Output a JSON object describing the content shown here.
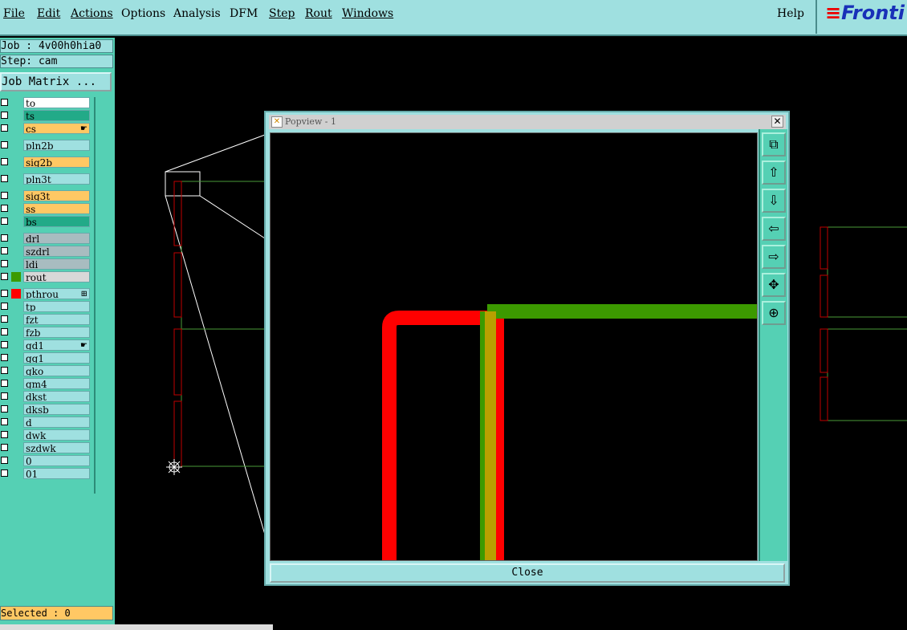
{
  "menu": {
    "file": "File",
    "edit": "Edit",
    "actions": "Actions",
    "options": "Options",
    "analysis": "Analysis",
    "dfm": "DFM",
    "step": "Step",
    "rout": "Rout",
    "windows": "Windows",
    "help": "Help"
  },
  "brand": {
    "logo": "Fronti",
    "color": "#1830b8"
  },
  "panel": {
    "job": "Job : 4v00h0hia0",
    "step": "Step: cam",
    "job_matrix": "Job Matrix ...",
    "selected": "Selected : 0"
  },
  "layers": [
    {
      "name": "to",
      "bg": "#ffffff",
      "swatch": "",
      "mark": ""
    },
    {
      "name": "ts",
      "bg": "#22aa88",
      "swatch": "",
      "mark": ""
    },
    {
      "name": "cs",
      "bg": "#ffc864",
      "swatch": "",
      "mark": "hand-icon"
    },
    {
      "name": "pln2b",
      "bg": "#9fe0e0",
      "swatch": "",
      "mark": ""
    },
    {
      "name": "sig2b",
      "bg": "#ffc864",
      "swatch": "",
      "mark": ""
    },
    {
      "name": "pln3t",
      "bg": "#9fe0e0",
      "swatch": "",
      "mark": ""
    },
    {
      "name": "sig3t",
      "bg": "#ffc864",
      "swatch": "",
      "mark": ""
    },
    {
      "name": "ss",
      "bg": "#ffc864",
      "swatch": "",
      "mark": ""
    },
    {
      "name": "bs",
      "bg": "#22aa88",
      "swatch": "",
      "mark": ""
    },
    {
      "name": "drl",
      "bg": "#a8bcc0",
      "swatch": "",
      "mark": ""
    },
    {
      "name": "szdrl",
      "bg": "#a8bcc0",
      "swatch": "",
      "mark": ""
    },
    {
      "name": "ldi",
      "bg": "#a8bcc0",
      "swatch": "",
      "mark": ""
    },
    {
      "name": "rout",
      "bg": "#d8d8d8",
      "swatch": "#3c9a00",
      "mark": ""
    },
    {
      "name": "pthrou",
      "bg": "#9fe0e0",
      "swatch": "#ff0000",
      "mark": "grid-icon"
    },
    {
      "name": "tp",
      "bg": "#9fe0e0",
      "swatch": "",
      "mark": ""
    },
    {
      "name": "fzt",
      "bg": "#9fe0e0",
      "swatch": "",
      "mark": ""
    },
    {
      "name": "fzb",
      "bg": "#9fe0e0",
      "swatch": "",
      "mark": ""
    },
    {
      "name": "gd1",
      "bg": "#9fe0e0",
      "swatch": "",
      "mark": "hand-icon"
    },
    {
      "name": "gg1",
      "bg": "#9fe0e0",
      "swatch": "",
      "mark": ""
    },
    {
      "name": "gko",
      "bg": "#9fe0e0",
      "swatch": "",
      "mark": ""
    },
    {
      "name": "gm4",
      "bg": "#9fe0e0",
      "swatch": "",
      "mark": ""
    },
    {
      "name": "dkst",
      "bg": "#9fe0e0",
      "swatch": "",
      "mark": ""
    },
    {
      "name": "dksb",
      "bg": "#9fe0e0",
      "swatch": "",
      "mark": ""
    },
    {
      "name": "d",
      "bg": "#9fe0e0",
      "swatch": "",
      "mark": ""
    },
    {
      "name": "dwk",
      "bg": "#9fe0e0",
      "swatch": "",
      "mark": ""
    },
    {
      "name": "szdwk",
      "bg": "#9fe0e0",
      "swatch": "",
      "mark": ""
    },
    {
      "name": "0",
      "bg": "#9fe0e0",
      "swatch": "",
      "mark": ""
    },
    {
      "name": "01",
      "bg": "#9fe0e0",
      "swatch": "",
      "mark": ""
    }
  ],
  "popview": {
    "title": "Popview - 1",
    "close_label": "Close",
    "toolbar_icons": [
      "zoom-window-icon",
      "pan-up-icon",
      "pan-down-icon",
      "pan-left-icon",
      "pan-right-icon",
      "zoom-fit-icon",
      "zoom-home-icon"
    ]
  },
  "colors": {
    "menu_bg": "#9fe0e0",
    "panel_bg": "#55d0b4",
    "trace_red": "#ff0000",
    "trace_green": "#3c9a00",
    "trace_overlap": "#b8a000"
  }
}
